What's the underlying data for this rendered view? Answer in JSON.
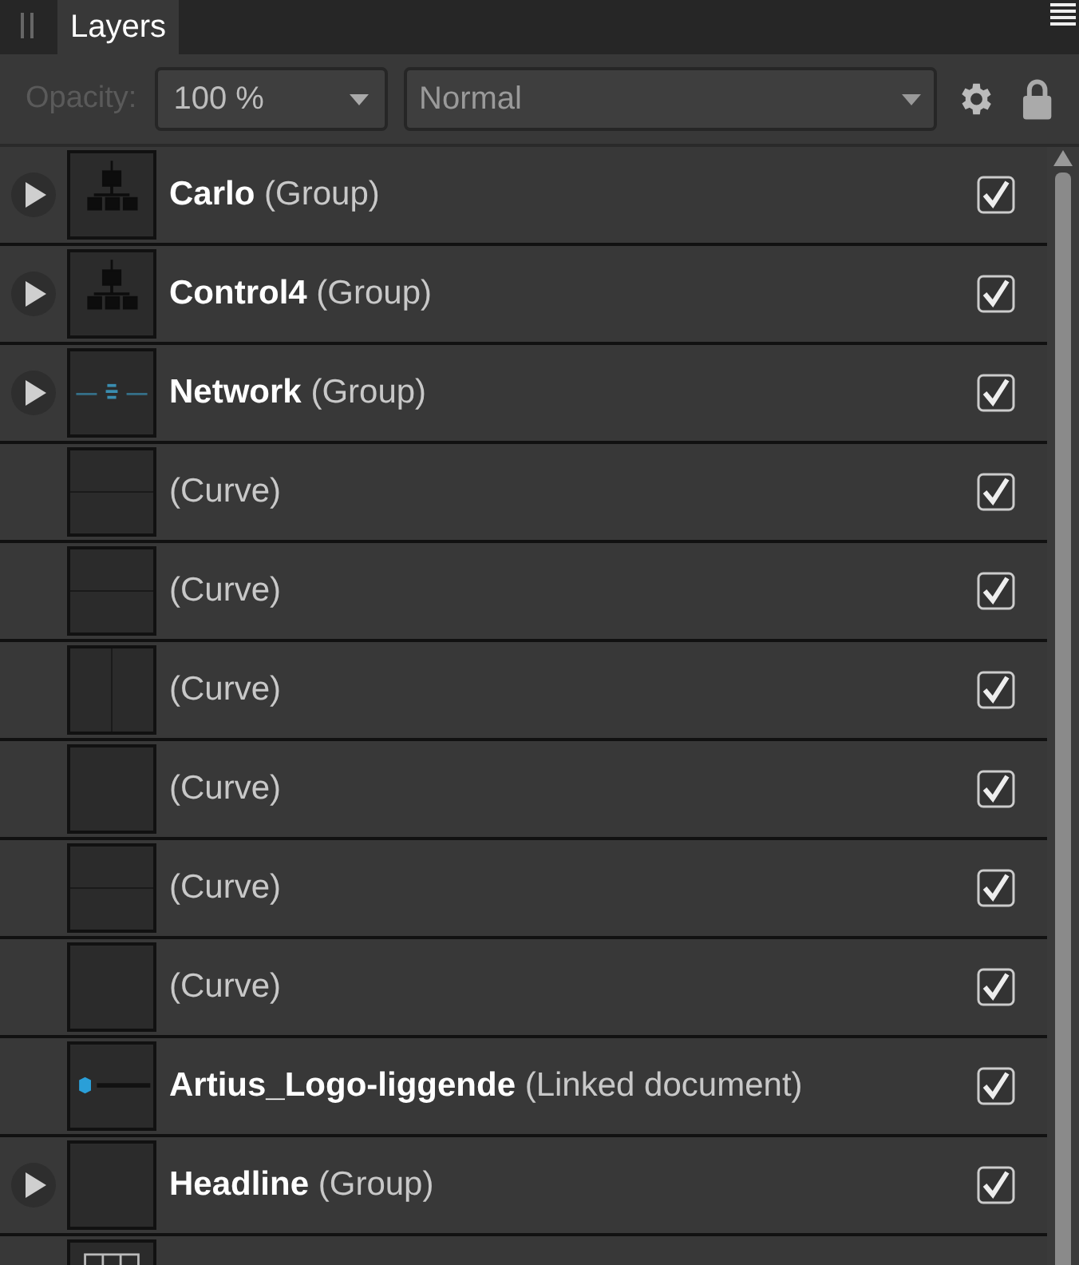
{
  "panel": {
    "tab": "Layers"
  },
  "toolbar": {
    "opacity_label": "Opacity:",
    "opacity": "100 %",
    "blend_mode": "Normal"
  },
  "layers": [
    {
      "name": "Carlo",
      "type": "(Group)",
      "expandable": true,
      "checked": true,
      "kind": "hierarchy"
    },
    {
      "name": "Control4",
      "type": "(Group)",
      "expandable": true,
      "checked": true,
      "kind": "hierarchy"
    },
    {
      "name": "Network",
      "type": "(Group)",
      "expandable": true,
      "checked": true,
      "kind": "network"
    },
    {
      "type": "(Curve)",
      "expandable": false,
      "checked": true,
      "kind": "hline"
    },
    {
      "type": "(Curve)",
      "expandable": false,
      "checked": true,
      "kind": "hline"
    },
    {
      "type": "(Curve)",
      "expandable": false,
      "checked": true,
      "kind": "vline"
    },
    {
      "type": "(Curve)",
      "expandable": false,
      "checked": true,
      "kind": "blank"
    },
    {
      "type": "(Curve)",
      "expandable": false,
      "checked": true,
      "kind": "hline"
    },
    {
      "type": "(Curve)",
      "expandable": false,
      "checked": true,
      "kind": "blank"
    },
    {
      "name": "Artius_Logo-liggende",
      "type": "(Linked document)",
      "expandable": false,
      "checked": true,
      "kind": "logo"
    },
    {
      "name": "Headline",
      "type": "(Group)",
      "expandable": true,
      "checked": true,
      "kind": "blank"
    },
    {
      "kind": "grid"
    }
  ]
}
